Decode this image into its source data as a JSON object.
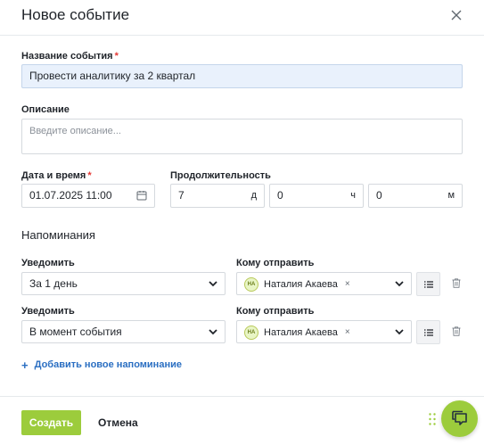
{
  "dialog": {
    "title": "Новое событие",
    "close_icon": "close-icon"
  },
  "form": {
    "name": {
      "label": "Название события",
      "required_mark": "*",
      "value": "Провести аналитику за 2 квартал"
    },
    "description": {
      "label": "Описание",
      "placeholder": "Введите описание..."
    },
    "datetime": {
      "label": "Дата и время",
      "required_mark": "*",
      "value": "01.07.2025 11:00",
      "icon": "calendar-icon"
    },
    "duration": {
      "label": "Продолжительность",
      "days": {
        "value": "7",
        "unit": "д"
      },
      "hours": {
        "value": "0",
        "unit": "ч"
      },
      "minutes": {
        "value": "0",
        "unit": "м"
      }
    }
  },
  "reminders": {
    "heading": "Напоминания",
    "items": [
      {
        "notify_label": "Уведомить",
        "notify_value": "За 1 день",
        "recipient_label": "Кому отправить",
        "recipient_initials": "НА",
        "recipient_name": "Наталия Акаева",
        "chip_remove": "×"
      },
      {
        "notify_label": "Уведомить",
        "notify_value": "В момент события",
        "recipient_label": "Кому отправить",
        "recipient_initials": "НА",
        "recipient_name": "Наталия Акаева",
        "chip_remove": "×"
      }
    ],
    "add_icon": "+",
    "add_label": "Добавить новое напоминание"
  },
  "footer": {
    "create_label": "Создать",
    "cancel_label": "Отмена"
  },
  "colors": {
    "accent": "#9ccc3c",
    "link": "#2b6fc2",
    "required": "#e53935",
    "filled_field": "#e9f1fc"
  }
}
